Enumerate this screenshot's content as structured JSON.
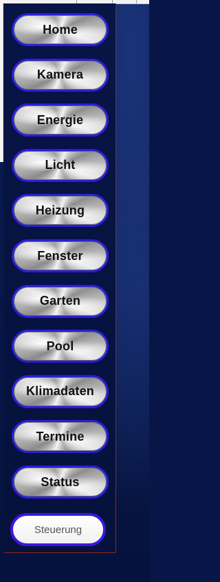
{
  "nav": {
    "items": [
      {
        "label": "Home"
      },
      {
        "label": "Kamera"
      },
      {
        "label": "Energie"
      },
      {
        "label": "Licht"
      },
      {
        "label": "Heizung"
      },
      {
        "label": "Fenster"
      },
      {
        "label": "Garten"
      },
      {
        "label": "Pool"
      },
      {
        "label": "Klimadaten"
      },
      {
        "label": "Termine"
      },
      {
        "label": "Status"
      }
    ]
  },
  "footer": {
    "steuerung_label": "Steuerung"
  },
  "colors": {
    "background": "#071647",
    "button_border": "#2a1fd6",
    "frame_border": "#8a2a1a",
    "steuerung_border": "#3a18e0"
  }
}
